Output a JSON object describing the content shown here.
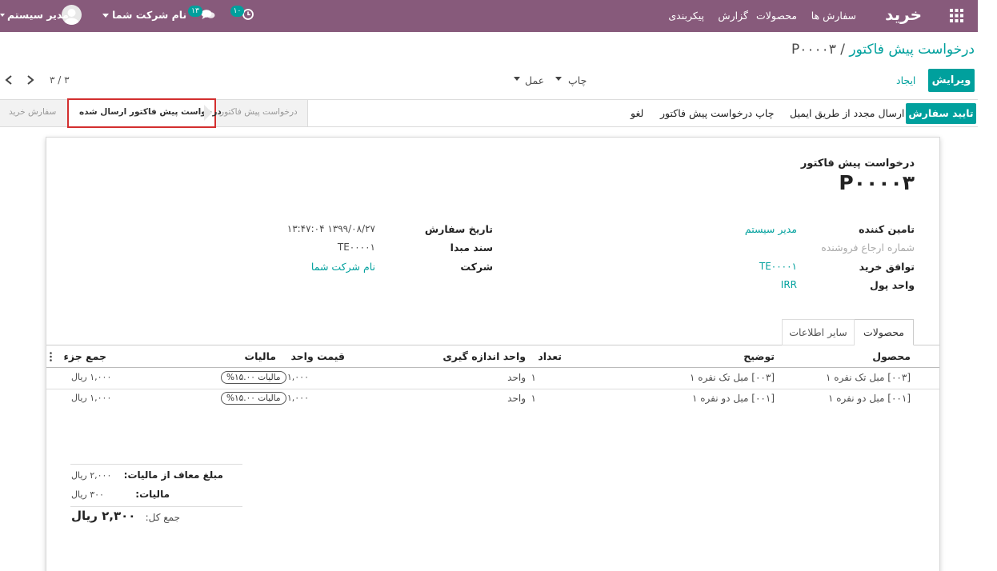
{
  "topbar": {
    "app_name": "خرید",
    "menu": [
      "سفارش ها",
      "محصولات",
      "گزارش",
      "پیکربندی"
    ],
    "company": "نام شرکت شما",
    "user": "مدیر سیستم",
    "activity_count": "۱۰",
    "message_count": "۱۳",
    "bg_color": "#875a7b"
  },
  "breadcrumb": {
    "parent": "درخواست پیش فاکتور",
    "separator": "/",
    "current": "P۰۰۰۰۳"
  },
  "control": {
    "edit_label": "ویرایش",
    "create_label": "ایجاد",
    "print_label": "چاپ",
    "action_label": "عمل",
    "pager": "۳ / ۳"
  },
  "statusbar": {
    "buttons": [
      "تایید سفارش",
      "ارسال مجدد از طریق ایمیل",
      "چاپ درخواست پیش فاکتور",
      "لغو"
    ],
    "stages": [
      "درخواست پیش فاکتور",
      "درخواست پیش فاکتور ارسال شده",
      "سفارش خرید"
    ],
    "active_stage": "درخواست پیش فاکتور ارسال شده"
  },
  "form": {
    "doc_type": "درخواست پیش فاکتور",
    "name": "P۰۰۰۰۳",
    "left_fields": [
      {
        "label": "تامین کننده",
        "value": "مدیر سیستم",
        "kind": "link"
      },
      {
        "label": "شماره ارجاع فروشنده",
        "value": "",
        "kind": "placeholder"
      },
      {
        "label": "توافق خرید",
        "value": "TE۰۰۰۰۱",
        "kind": "link"
      },
      {
        "label": "واحد پول",
        "value": "IRR",
        "kind": "link"
      }
    ],
    "right_fields": [
      {
        "label": "تاریخ سفارش",
        "value": "۱۳۹۹/۰۸/۲۷ ۱۳:۴۷:۰۴",
        "kind": "text"
      },
      {
        "label": "سند مبدا",
        "value": "TE۰۰۰۰۱",
        "kind": "text"
      },
      {
        "label": "شرکت",
        "value": "نام شرکت شما",
        "kind": "link"
      }
    ],
    "tabs": [
      "محصولات",
      "سایر اطلاعات"
    ]
  },
  "lines": {
    "headers": {
      "product": "محصول",
      "description": "توضیح",
      "qty": "تعداد",
      "uom": "واحد اندازه گیری",
      "price": "قیمت واحد",
      "taxes": "مالیات",
      "subtotal": "جمع جزء"
    },
    "rows": [
      {
        "product": "[۰۰۳] مبل تک نفره ۱",
        "description": "[۰۰۳] مبل تک نفره ۱",
        "qty": "۱",
        "uom": "واحد",
        "price": "۱,۰۰۰",
        "tax": "مالیات ۱۵.۰۰%",
        "subtotal": "۱,۰۰۰ ریال"
      },
      {
        "product": "[۰۰۱] مبل دو نفره ۱",
        "description": "[۰۰۱] مبل دو نفره ۱",
        "qty": "۱",
        "uom": "واحد",
        "price": "۱,۰۰۰",
        "tax": "مالیات ۱۵.۰۰%",
        "subtotal": "۱,۰۰۰ ریال"
      }
    ]
  },
  "totals": {
    "untaxed_label": "مبلغ معاف از مالیات:",
    "untaxed_value": "۲,۰۰۰ ریال",
    "tax_label": "مالیات:",
    "tax_value": "۳۰۰ ریال",
    "total_label": "جمع کل:",
    "total_value": "۲,۳۰۰ ریال"
  },
  "colors": {
    "accent": "#00a09d",
    "brand": "#875a7b",
    "highlight_border": "#d32f2f"
  }
}
